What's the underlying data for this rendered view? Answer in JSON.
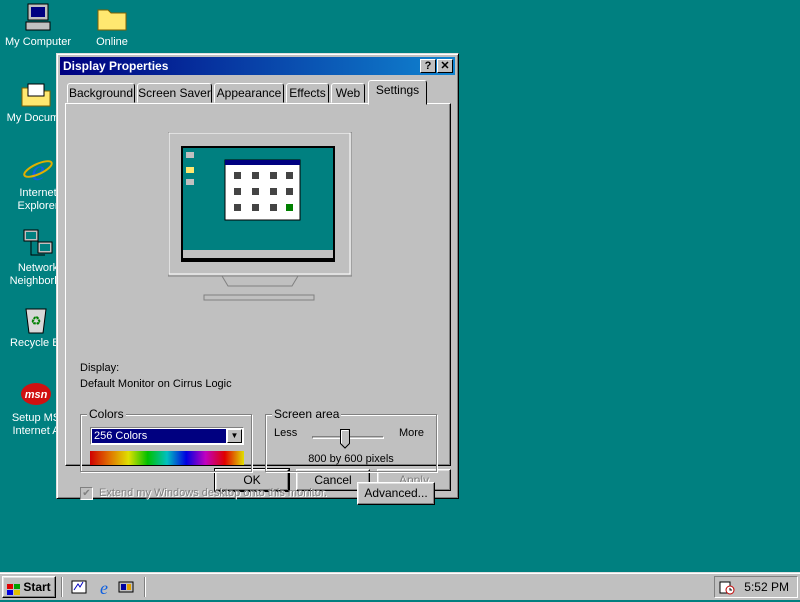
{
  "desktop": {
    "icons": [
      {
        "label": "My Computer"
      },
      {
        "label": "Online"
      },
      {
        "label": "My Docume"
      },
      {
        "label": "Internet\nExplorer"
      },
      {
        "label": "Network\nNeighborho"
      },
      {
        "label": "Recycle Bi"
      },
      {
        "label": "Setup MS\nInternet A"
      }
    ],
    "msn_text": "msn"
  },
  "window": {
    "title": "Display Properties",
    "help_btn": "?",
    "close_btn": "✕",
    "tabs": [
      "Background",
      "Screen Saver",
      "Appearance",
      "Effects",
      "Web",
      "Settings"
    ],
    "active_tab": "Settings",
    "display_label": "Display:",
    "display_value": "Default Monitor on Cirrus Logic",
    "colors": {
      "group_title": "Colors",
      "selected": "256 Colors"
    },
    "screen_area": {
      "group_title": "Screen area",
      "less": "Less",
      "more": "More",
      "value_text": "800 by 600 pixels",
      "slider_level": 0.45
    },
    "extend_checkbox": {
      "label": "Extend my Windows desktop onto this monitor.",
      "checked": true,
      "enabled": false
    },
    "advanced_btn": "Advanced...",
    "ok_btn": "OK",
    "cancel_btn": "Cancel",
    "apply_btn": "Apply"
  },
  "taskbar": {
    "start_label": "Start",
    "clock": "5:52 PM"
  },
  "colors": {
    "desktop": "#008080",
    "titlebar": "#000080",
    "face": "#c0c0c0"
  }
}
